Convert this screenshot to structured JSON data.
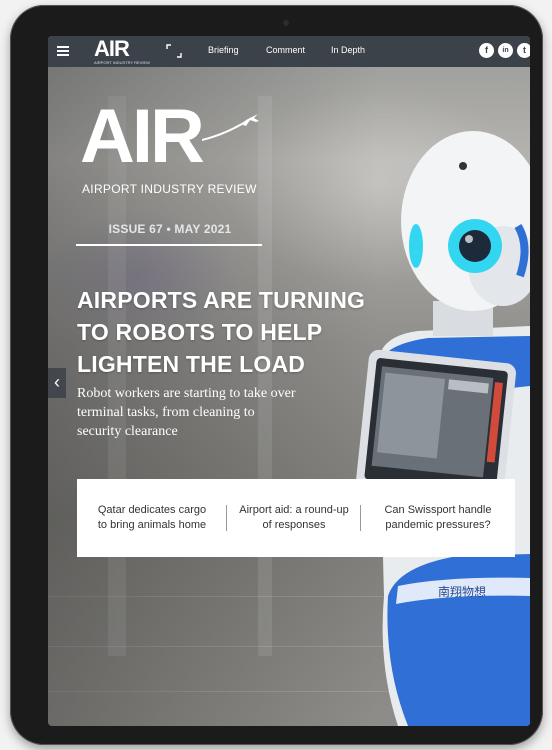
{
  "nav": {
    "logo_text": "AIR",
    "logo_sub": "AIRPORT INDUSTRY REVIEW",
    "links": [
      "Briefing",
      "Comment",
      "In Depth"
    ],
    "social": [
      "f",
      "in",
      "t"
    ]
  },
  "masthead": {
    "title": "AIR",
    "tagline": "AIRPORT INDUSTRY REVIEW"
  },
  "issue": "ISSUE 67 • MAY 2021",
  "headline": [
    "AIRPORTS ARE TURNING",
    "TO ROBOTS TO HELP",
    "LIGHTEN THE LOAD"
  ],
  "standfirst": [
    "Robot workers are starting to take over",
    "terminal tasks, from cleaning to",
    "security clearance"
  ],
  "related": [
    {
      "lines": [
        "Qatar dedicates cargo",
        "to bring animals home"
      ]
    },
    {
      "lines": [
        "Airport aid: a round-up",
        "of responses"
      ]
    },
    {
      "lines": [
        "Can Swissport handle",
        "pandemic pressures?"
      ]
    }
  ],
  "robot_label": "南翔物想",
  "colors": {
    "topbar": "#3c4249",
    "robot_blue": "#2f6fd6",
    "robot_eye": "#33d6f0"
  },
  "icons": [
    "menu-icon",
    "expand-icon",
    "facebook-icon",
    "linkedin-icon",
    "twitter-icon",
    "plane-icon",
    "chevron-left-icon"
  ]
}
